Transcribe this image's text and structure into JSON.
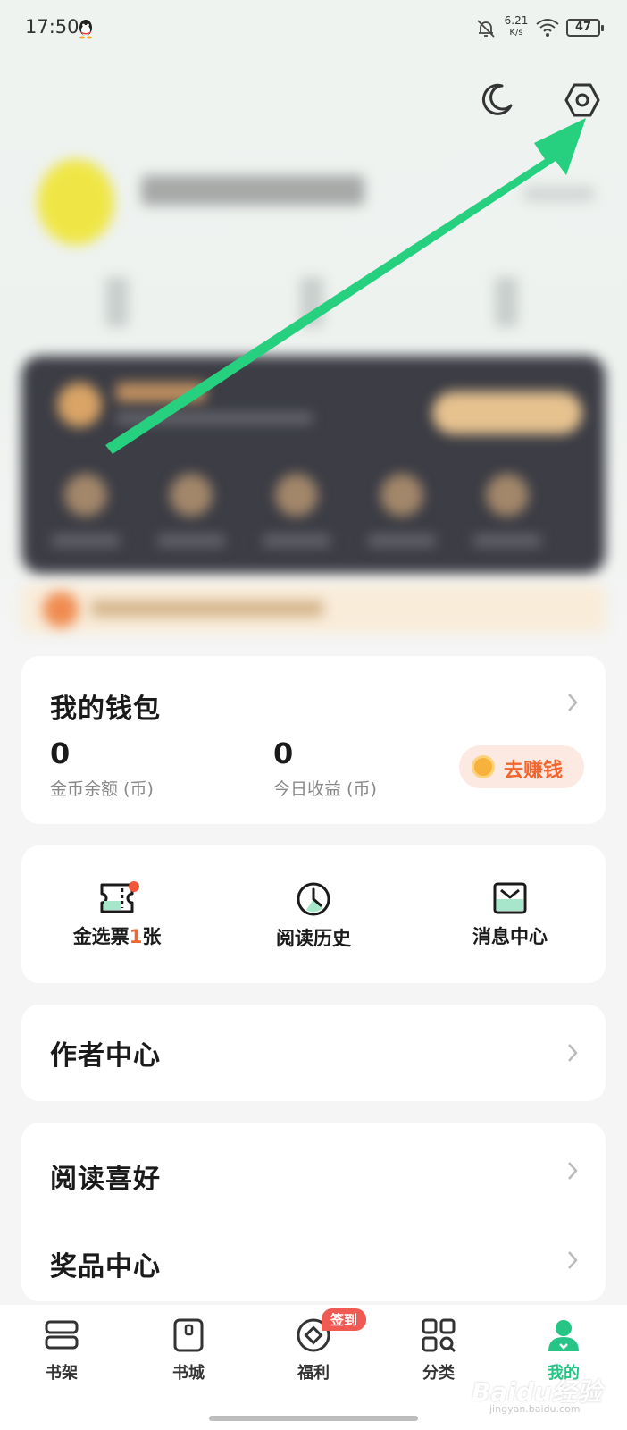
{
  "status_bar": {
    "time": "17:50",
    "net_speed": "6.21",
    "net_unit": "K/s",
    "battery": "47"
  },
  "wallet": {
    "title": "我的钱包",
    "coin_balance_value": "0",
    "coin_balance_label": "金币余额 (币)",
    "today_income_value": "0",
    "today_income_label": "今日收益 (币)",
    "earn_button": "去赚钱"
  },
  "quick": {
    "ticket_prefix": "金选票",
    "ticket_count": "1",
    "ticket_suffix": "张",
    "history": "阅读历史",
    "messages": "消息中心"
  },
  "menu": {
    "author_center": "作者中心",
    "reading_pref": "阅读喜好",
    "prize_center": "奖品中心"
  },
  "nav": {
    "bookshelf": "书架",
    "bookstore": "书城",
    "welfare": "福利",
    "welfare_badge": "签到",
    "category": "分类",
    "mine": "我的"
  },
  "watermark": {
    "brand": "Baidu经验",
    "url": "jingyan.baidu.com"
  },
  "colors": {
    "accent": "#26c485",
    "earn": "#f2662e",
    "badge": "#ef5b52"
  }
}
